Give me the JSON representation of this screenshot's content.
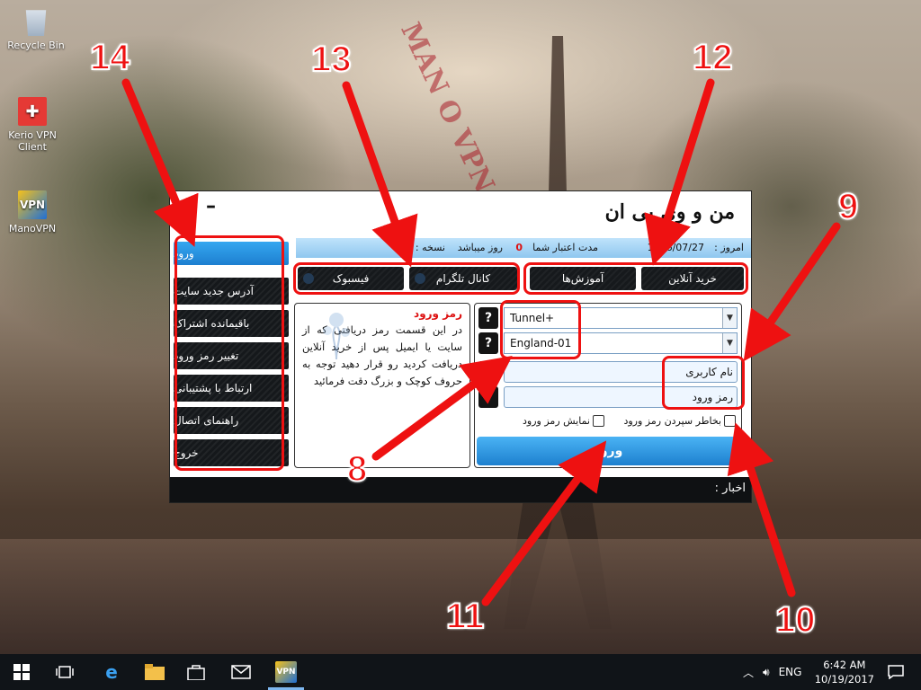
{
  "desktop": {
    "icons": [
      {
        "label": "Recycle Bin",
        "icon": "recycle-bin-icon"
      },
      {
        "label": "Kerio VPN Client",
        "icon": "kerio-vpn-icon"
      },
      {
        "label": "ManoVPN",
        "icon": "manovpn-icon"
      }
    ],
    "watermark": "MAN O VPN"
  },
  "app": {
    "title": "من و وی پی ان",
    "minimize": "–",
    "close": "×",
    "info": {
      "today_label": "امروز :",
      "today_value": "1396/07/27",
      "validity_label": "مدت اعتبار شما",
      "validity_value": "0",
      "validity_unit": "روز میباشد",
      "version_label": "نسخه : 1"
    },
    "top_buttons": {
      "buy_online": "خرید آنلاین",
      "tutorials": "آموزش‌ها",
      "telegram": "کانال تلگرام",
      "facebook": "فیسبوک"
    },
    "sidebar": [
      {
        "label": "ورود",
        "active": true
      },
      {
        "label": "آدرس جدید سایت"
      },
      {
        "label": "باقیمانده اشتراک"
      },
      {
        "label": "تغییر رمز ورود"
      },
      {
        "label": "ارتباط با پشتیبانی"
      },
      {
        "label": "راهنمای اتصال"
      },
      {
        "label": "خروج"
      }
    ],
    "info_panel": {
      "title": "رمز ورود",
      "body": "در این قسمت رمز دریافتی که از سایت یا ایمیل پس از خرید آنلاین دریافت کردید رو قرار دهید توجه به حروف کوچک و بزرگ دقت فرمائید"
    },
    "form": {
      "protocol": "Tunnel+",
      "server": "England-01",
      "username_label": "نام کاربری",
      "password_label": "رمز ورود",
      "remember_label": "بخاطر سپردن رمز ورود",
      "show_password_label": "نمایش رمز ورود",
      "help": "?",
      "login_button": "ورود"
    },
    "news_label": "اخبار :"
  },
  "annotations": {
    "n8": "8",
    "n9": "9",
    "n10": "10",
    "n11": "11",
    "n12": "12",
    "n13": "13",
    "n14": "14"
  },
  "taskbar": {
    "language": "ENG",
    "time": "6:42 AM",
    "date": "10/19/2017"
  },
  "colors": {
    "accent": "#1d80cf",
    "annotation": "#e11111",
    "panel_dark": "#15181b"
  }
}
